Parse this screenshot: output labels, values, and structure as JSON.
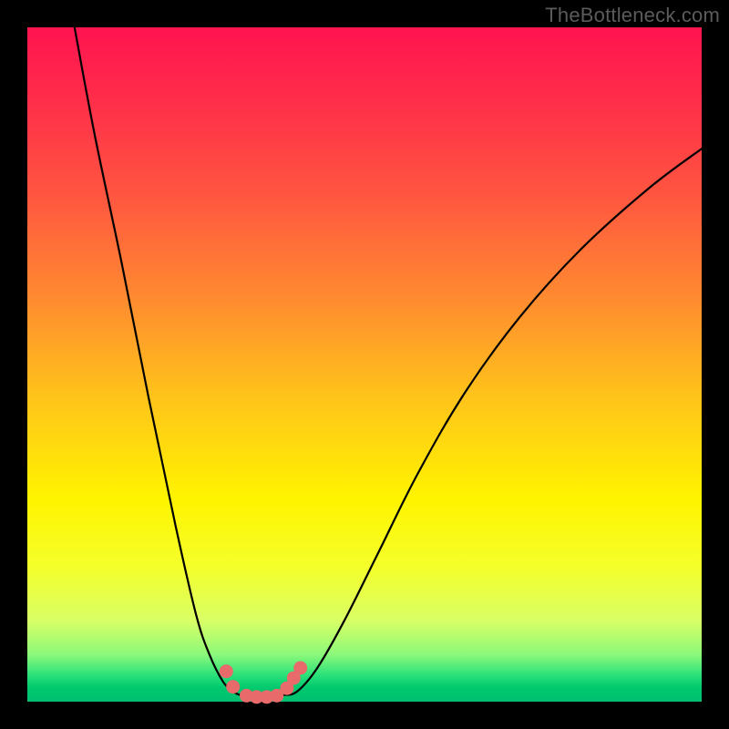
{
  "watermark": "TheBottleneck.com",
  "chart_data": {
    "type": "line",
    "title": "",
    "xlabel": "",
    "ylabel": "",
    "xlim": [
      0,
      100
    ],
    "ylim": [
      0,
      100
    ],
    "grid": false,
    "legend": false,
    "series": [
      {
        "name": "left-curve",
        "x": [
          7,
          10,
          14,
          18,
          22,
          25,
          27,
          29,
          30.5,
          31.5
        ],
        "y": [
          100,
          84,
          65,
          45,
          26,
          13,
          7,
          3,
          1.5,
          1.0
        ]
      },
      {
        "name": "right-curve",
        "x": [
          38,
          40,
          43,
          47,
          52,
          58,
          65,
          73,
          82,
          92,
          100
        ],
        "y": [
          1.0,
          1.5,
          5,
          12,
          22,
          34,
          46,
          57,
          67,
          76,
          82
        ]
      },
      {
        "name": "valley-floor",
        "x": [
          31.5,
          33,
          35,
          37,
          38
        ],
        "y": [
          1.0,
          0.7,
          0.6,
          0.7,
          1.0
        ]
      }
    ],
    "markers": [
      {
        "name": "left-dot-1",
        "x": 29.5,
        "y": 4.5
      },
      {
        "name": "left-dot-2",
        "x": 30.5,
        "y": 2.2
      },
      {
        "name": "floor-dot-1",
        "x": 32.5,
        "y": 0.9
      },
      {
        "name": "floor-dot-2",
        "x": 34.0,
        "y": 0.7
      },
      {
        "name": "floor-dot-3",
        "x": 35.5,
        "y": 0.7
      },
      {
        "name": "floor-dot-4",
        "x": 37.0,
        "y": 0.9
      },
      {
        "name": "right-dot-1",
        "x": 38.5,
        "y": 2.0
      },
      {
        "name": "right-dot-2",
        "x": 39.5,
        "y": 3.5
      },
      {
        "name": "right-dot-3",
        "x": 40.5,
        "y": 5.0
      }
    ],
    "colors": {
      "curve": "#000000",
      "marker_fill": "#e86a6a",
      "marker_stroke": "#c94747"
    }
  }
}
